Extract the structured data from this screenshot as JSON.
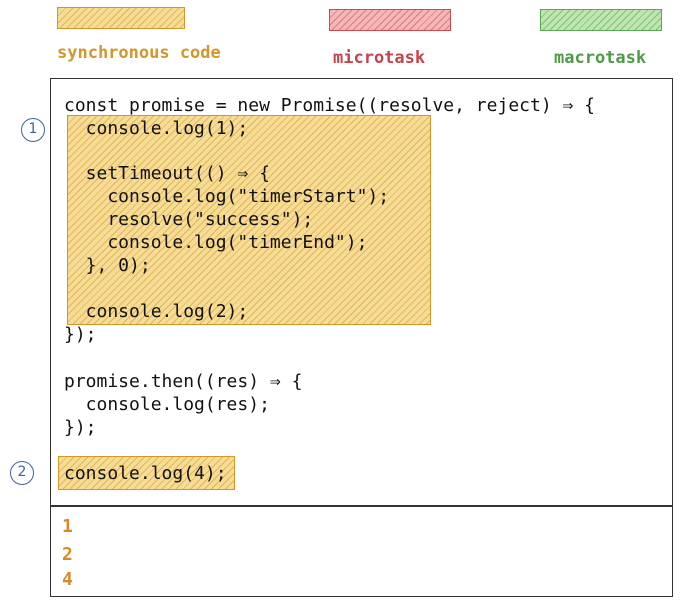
{
  "legend": [
    {
      "label": "synchronous code",
      "color": "#d4962a"
    },
    {
      "label": "microtask",
      "color": "#c64449"
    },
    {
      "label": "macrotask",
      "color": "#4f9a47"
    }
  ],
  "code": [
    "const promise = new Promise((resolve, reject) ⇒ {",
    "  console.log(1);",
    "",
    "  setTimeout(() ⇒ {",
    "    console.log(\"timerStart\");",
    "    resolve(\"success\");",
    "    console.log(\"timerEnd\");",
    "  }, 0);",
    "",
    "  console.log(2);",
    "});",
    "",
    "promise.then((res) ⇒ {",
    "  console.log(res);",
    "});",
    "",
    "console.log(4);"
  ],
  "markers": [
    "1",
    "2"
  ],
  "output": [
    "1",
    "2",
    "4"
  ]
}
